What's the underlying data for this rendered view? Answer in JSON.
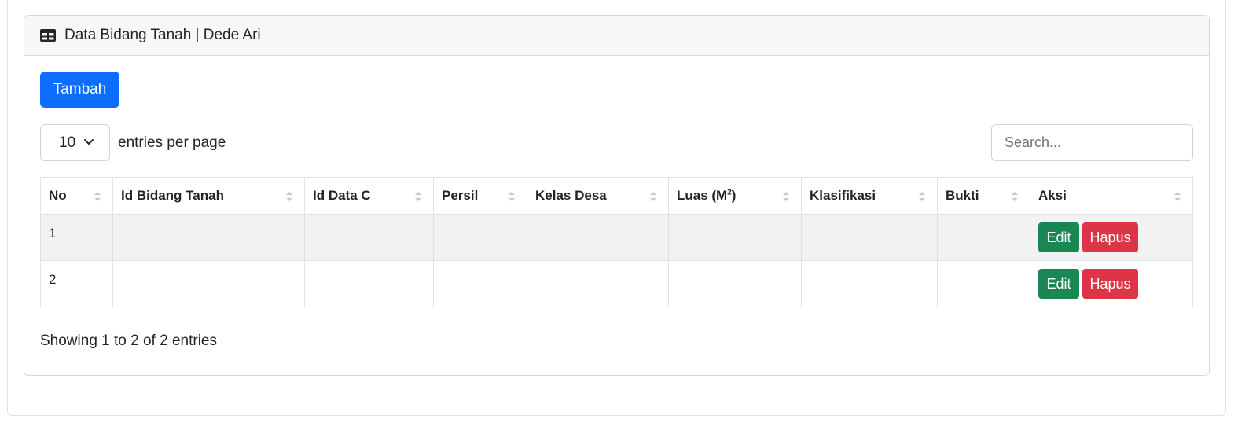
{
  "card": {
    "title": "Data Bidang Tanah | Dede Ari",
    "icon": "table-icon"
  },
  "toolbar": {
    "add_label": "Tambah",
    "per_page_value": "10",
    "per_page_label": "entries per page",
    "search_placeholder": "Search..."
  },
  "table": {
    "columns": [
      {
        "label": "No"
      },
      {
        "label": "Id Bidang Tanah"
      },
      {
        "label": "Id Data C"
      },
      {
        "label": "Persil"
      },
      {
        "label": "Kelas Desa"
      },
      {
        "label": "Luas (M",
        "sup": "2",
        "suffix": ")"
      },
      {
        "label": "Klasifikasi"
      },
      {
        "label": "Bukti"
      },
      {
        "label": "Aksi"
      }
    ],
    "rows": [
      {
        "no": "1",
        "edit_label": "Edit",
        "delete_label": "Hapus"
      },
      {
        "no": "2",
        "edit_label": "Edit",
        "delete_label": "Hapus"
      }
    ]
  },
  "footer": {
    "info": "Showing 1 to 2 of 2 entries"
  },
  "colors": {
    "primary": "#0d6efd",
    "success": "#198754",
    "danger": "#dc3545"
  }
}
